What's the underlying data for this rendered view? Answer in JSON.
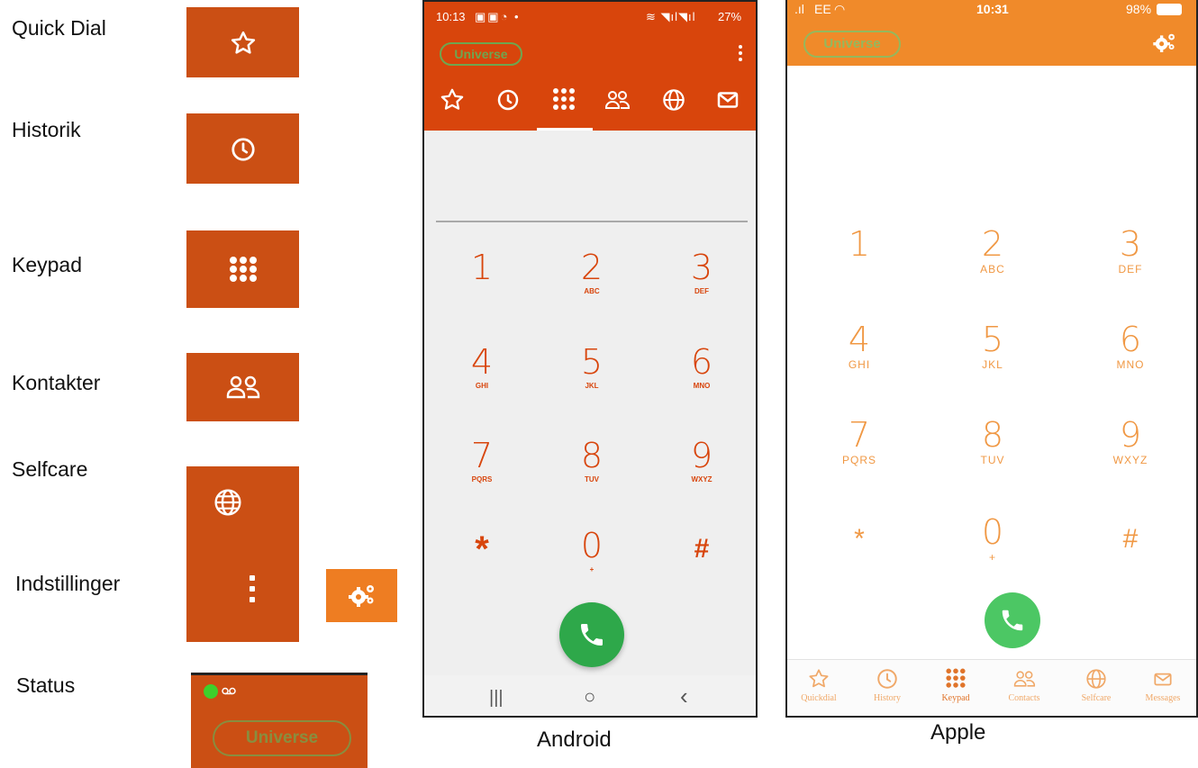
{
  "legend": {
    "items": [
      "Quick Dial",
      "Historik",
      "Keypad",
      "Kontakter",
      "Selfcare",
      "Indstillinger",
      "Status"
    ],
    "status_pill": "Universe"
  },
  "android": {
    "caption": "Android",
    "status_time": "10:13",
    "status_right": "27%",
    "account_pill": "Universe",
    "keys": [
      {
        "num": "1",
        "letters": ""
      },
      {
        "num": "2",
        "letters": "ABC"
      },
      {
        "num": "3",
        "letters": "DEF"
      },
      {
        "num": "4",
        "letters": "GHI"
      },
      {
        "num": "5",
        "letters": "JKL"
      },
      {
        "num": "6",
        "letters": "MNO"
      },
      {
        "num": "7",
        "letters": "PQRS"
      },
      {
        "num": "8",
        "letters": "TUV"
      },
      {
        "num": "9",
        "letters": "WXYZ"
      },
      {
        "num": "*",
        "letters": ""
      },
      {
        "num": "0",
        "letters": "+"
      },
      {
        "num": "#",
        "letters": ""
      }
    ],
    "nav": {
      "recent": "|||",
      "home": "○",
      "back": "‹"
    }
  },
  "apple": {
    "caption": "Apple",
    "status_carrier": "EE",
    "status_time": "10:31",
    "status_battery": "98%",
    "account_pill": "Universe",
    "keys": [
      {
        "num": "1",
        "letters": ""
      },
      {
        "num": "2",
        "letters": "ABC"
      },
      {
        "num": "3",
        "letters": "DEF"
      },
      {
        "num": "4",
        "letters": "GHI"
      },
      {
        "num": "5",
        "letters": "JKL"
      },
      {
        "num": "6",
        "letters": "MNO"
      },
      {
        "num": "7",
        "letters": "PQRS"
      },
      {
        "num": "8",
        "letters": "TUV"
      },
      {
        "num": "9",
        "letters": "WXYZ"
      },
      {
        "num": "*",
        "letters": ""
      },
      {
        "num": "0",
        "letters": "+"
      },
      {
        "num": "#",
        "letters": ""
      }
    ],
    "tabs": [
      "Quickdial",
      "History",
      "Keypad",
      "Contacts",
      "Selfcare",
      "Messages"
    ],
    "active_tab": "Keypad"
  },
  "colors": {
    "android_orange": "#d8450c",
    "apple_orange": "#f08a2a",
    "legend_swatch": "#cb4f14",
    "call_green": "#2ea84a",
    "status_green": "#5cb85c"
  },
  "icons": [
    "star-icon",
    "clock-icon",
    "keypad-icon",
    "contacts-icon",
    "globe-icon",
    "more-vertical-icon",
    "gears-icon",
    "voicemail-icon",
    "message-icon",
    "phone-icon"
  ]
}
